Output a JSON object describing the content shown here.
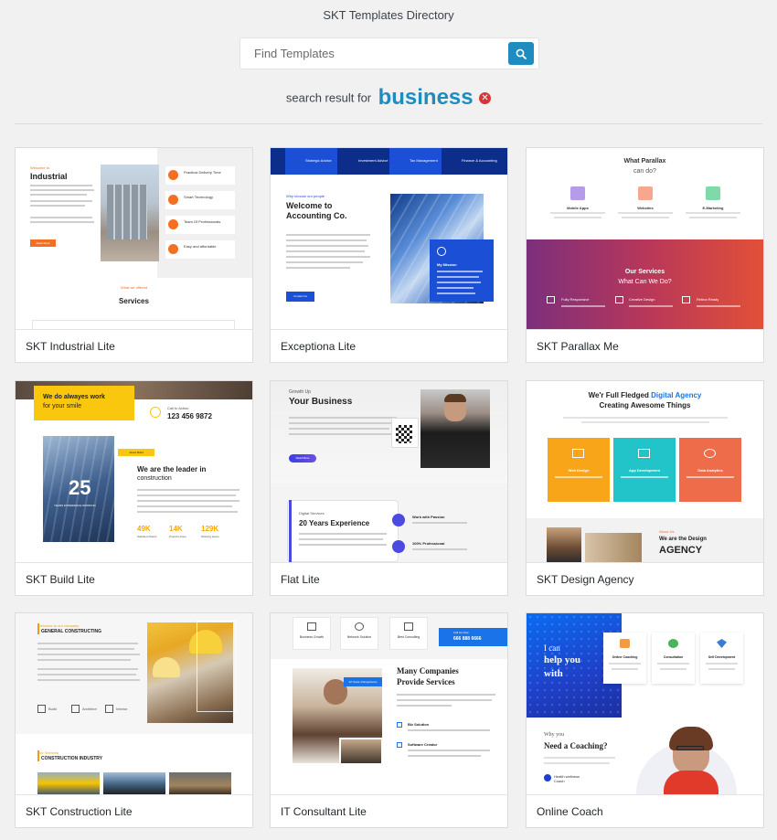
{
  "header": {
    "title": "SKT Templates Directory"
  },
  "search": {
    "placeholder": "Find Templates",
    "button_icon": "search-icon"
  },
  "result": {
    "label": "search result for",
    "term": "business",
    "clear_icon": "close-icon"
  },
  "colors": {
    "accent": "#1e8cbe",
    "clear": "#d63638",
    "background": "#f1f1f1"
  },
  "templates": [
    {
      "name": "SKT Industrial Lite",
      "thumb": {
        "welcome": "Welcome to",
        "heading": "Industrial",
        "button": "Read More",
        "kicker": "What we offered",
        "section": "Services",
        "features": [
          "Practical Delivery Time",
          "Smart Technology",
          "Team Of Professionals",
          "Easy and affordable"
        ]
      }
    },
    {
      "name": "Exceptiona Lite",
      "thumb": {
        "nav": [
          "Strategic Advice",
          "Investment Advice",
          "Tax Management",
          "Finance & Accounting"
        ],
        "kicker": "Why choose our people",
        "heading": "Welcome to",
        "heading2": "Accounting Co.",
        "box_title": "My Mission",
        "button": "Contact Us"
      }
    },
    {
      "name": "SKT Parallax Me",
      "thumb": {
        "heading": "What Parallax",
        "heading2": "can do?",
        "features": [
          "Mobile Apps",
          "Websites",
          "E-Marketing"
        ],
        "section": "Our Services",
        "section2": "What Can We Do?",
        "services": [
          "Fully Responsive",
          "Creative Design",
          "Retina Ready"
        ]
      }
    },
    {
      "name": "SKT Build Lite",
      "thumb": {
        "banner": "We do alwayes work",
        "banner2": "for your smile",
        "phone": "123 456 9872",
        "phone_label": "Call to Action",
        "years": "25",
        "years_label": "YEARS EXPERIENCE WORKING",
        "badge": "About Build",
        "heading": "We are the leader in",
        "heading2": "construction",
        "stats": [
          {
            "value": "49K",
            "label": "Satisfied Clients"
          },
          {
            "value": "14K",
            "label": "Projects Done"
          },
          {
            "value": "129K",
            "label": "Working Hours"
          }
        ]
      }
    },
    {
      "name": "Flat Lite",
      "thumb": {
        "kicker": "Growth Up",
        "heading": "Your Business",
        "button": "Read More",
        "kicker2": "Digital Services",
        "heading2": "20 Years Experience",
        "items": [
          "Work with Passion",
          "100% Professional"
        ]
      }
    },
    {
      "name": "SKT Design Agency",
      "thumb": {
        "heading": "We'r Full Fledged",
        "highlight": "Digital Agency",
        "heading2": "Creating Awesome Things",
        "services": [
          "Web Design",
          "App Development",
          "Data Analytics"
        ],
        "kicker": "About Us",
        "kicker2": "We are the Design",
        "heading3": "AGENCY"
      }
    },
    {
      "name": "SKT Construction Lite",
      "thumb": {
        "kicker": "Welcome to our company",
        "heading": "GENERAL CONSTRUCTING",
        "kicker2": "Our Services",
        "heading2": "CONSTRUCTION INDUSTRY",
        "features": [
          "Build",
          "Architect",
          "Interior"
        ]
      }
    },
    {
      "name": "IT Consultant Lite",
      "thumb": {
        "services": [
          "Business Growth",
          "Network Solution",
          "Best Consulting"
        ],
        "phone_label": "Call Us Now",
        "phone": "666 888 6666",
        "badge": "22 Years of Experience",
        "heading": "Many Companies",
        "heading2": "Provide Services",
        "items": [
          "Biz Solution",
          "Software Creator"
        ]
      }
    },
    {
      "name": "Online Coach",
      "thumb": {
        "tagline": "I can",
        "heading": "help you",
        "heading2": "with",
        "cards": [
          "Online Coaching",
          "Consultation",
          "Self Development"
        ],
        "kicker": "Why you",
        "heading3": "Need a Coaching?",
        "caption": "Health wellness Coach"
      }
    }
  ]
}
